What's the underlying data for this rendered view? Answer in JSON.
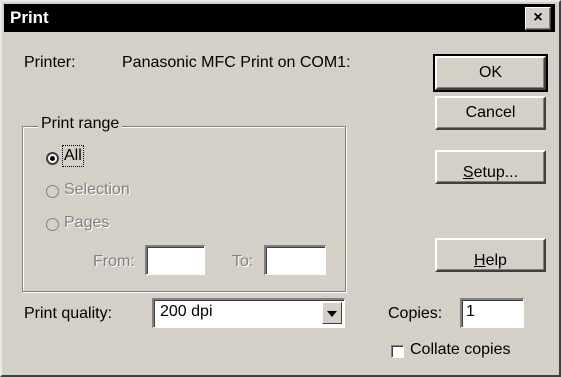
{
  "window": {
    "title": "Print",
    "close_glyph": "×"
  },
  "printer": {
    "label": "Printer:",
    "value": "Panasonic MFC Print on COM1:"
  },
  "buttons": {
    "ok": "OK",
    "cancel": "Cancel",
    "setup": "Setup...",
    "help": "Help"
  },
  "print_range": {
    "legend": "Print range",
    "options": [
      {
        "label": "All",
        "selected": true,
        "enabled": true
      },
      {
        "label": "Selection",
        "selected": false,
        "enabled": false
      },
      {
        "label": "Pages",
        "selected": false,
        "enabled": false
      }
    ],
    "from_label": "From:",
    "from_value": "",
    "to_label": "To:",
    "to_value": ""
  },
  "print_quality": {
    "label": "Print quality:",
    "value": "200 dpi"
  },
  "copies": {
    "label": "Copies:",
    "value": "1"
  },
  "collate": {
    "label": "Collate copies",
    "checked": false
  }
}
